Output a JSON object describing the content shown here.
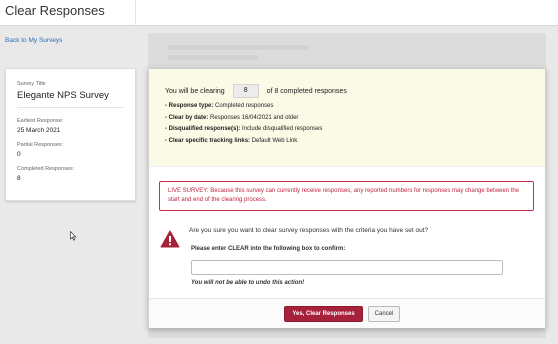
{
  "header": {
    "title": "Clear Responses"
  },
  "nav": {
    "back_link": "Back to My Surveys"
  },
  "survey": {
    "title_label": "Survey Title",
    "title": "Elegante NPS Survey",
    "earliest_label": "Earliest Response:",
    "earliest": "25 March 2021",
    "partial_label": "Partial Responses:",
    "partial": "0",
    "completed_label": "Completed Responses:",
    "completed": "8"
  },
  "modal": {
    "summary": {
      "prefix": "You will be clearing",
      "count": "8",
      "suffix": "of 8 completed responses",
      "criteria": [
        {
          "key": "- Response type:",
          "value": "Completed responses"
        },
        {
          "key": "- Clear by date:",
          "value": "Responses 16/04/2021 and older"
        },
        {
          "key": "- Disqualified response(s):",
          "value": "Include disqualified responses"
        },
        {
          "key": "- Clear specific tracking links:",
          "value": "Default Web Link"
        }
      ]
    },
    "warning": "LIVE SURVEY: Because this survey can currently receive responses, any reported numbers for responses may change between the start and end of the clearing process.",
    "question": "Are you sure you want to clear survey responses with the criteria you have set out?",
    "enter_label": "Please enter CLEAR into the following box to confirm:",
    "input_value": "",
    "undo_note": "You will not be able to undo this action!",
    "confirm_button": "Yes, Clear Responses",
    "cancel_button": "Cancel"
  },
  "colors": {
    "accent": "#a8213a",
    "warning": "#c0233f",
    "link": "#2a6fb5",
    "summary_bg": "#fafae6"
  },
  "icons": {
    "alert": "warning-triangle-icon",
    "cursor": "mouse-pointer-icon"
  }
}
